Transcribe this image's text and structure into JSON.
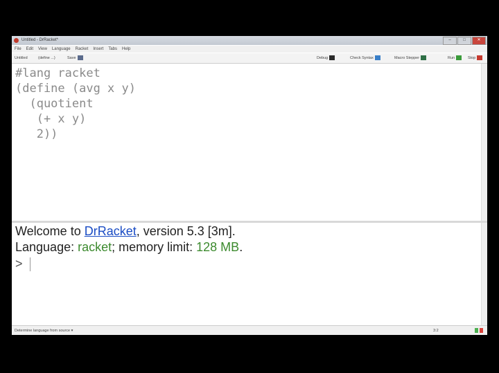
{
  "window": {
    "title": "Untitled - DrRacket*",
    "controls": [
      "–",
      "□",
      "✕"
    ]
  },
  "menubar": [
    "File",
    "Edit",
    "View",
    "Language",
    "Racket",
    "Insert",
    "Tabs",
    "Help"
  ],
  "toolbar": {
    "file_label": "Untitled",
    "define_label": "(define ...)",
    "save_label": "Save",
    "debug_label": "Debug",
    "check_syntax_label": "Check Syntax",
    "macro_stepper_label": "Macro Stepper",
    "run_label": "Run",
    "stop_label": "Stop"
  },
  "definitions": {
    "lines": [
      "#lang racket",
      "(define (avg x y)",
      "  (quotient",
      "   (+ x y)",
      "   2))"
    ]
  },
  "interactions": {
    "welcome_prefix": "Welcome to ",
    "app_link": "DrRacket",
    "welcome_suffix": ", version 5.3 [3m].",
    "language_prefix": "Language: ",
    "language_value": "racket",
    "memory_prefix": "; memory limit: ",
    "memory_value": "128 MB",
    "memory_suffix": ".",
    "prompt": ">"
  },
  "statusbar": {
    "language_selector": "Determine language from source ▾",
    "position": "3:2"
  },
  "colors": {
    "link": "#1a4cc4",
    "keyword_green": "#3c8a2e",
    "code_gray": "#8a8a8a"
  }
}
